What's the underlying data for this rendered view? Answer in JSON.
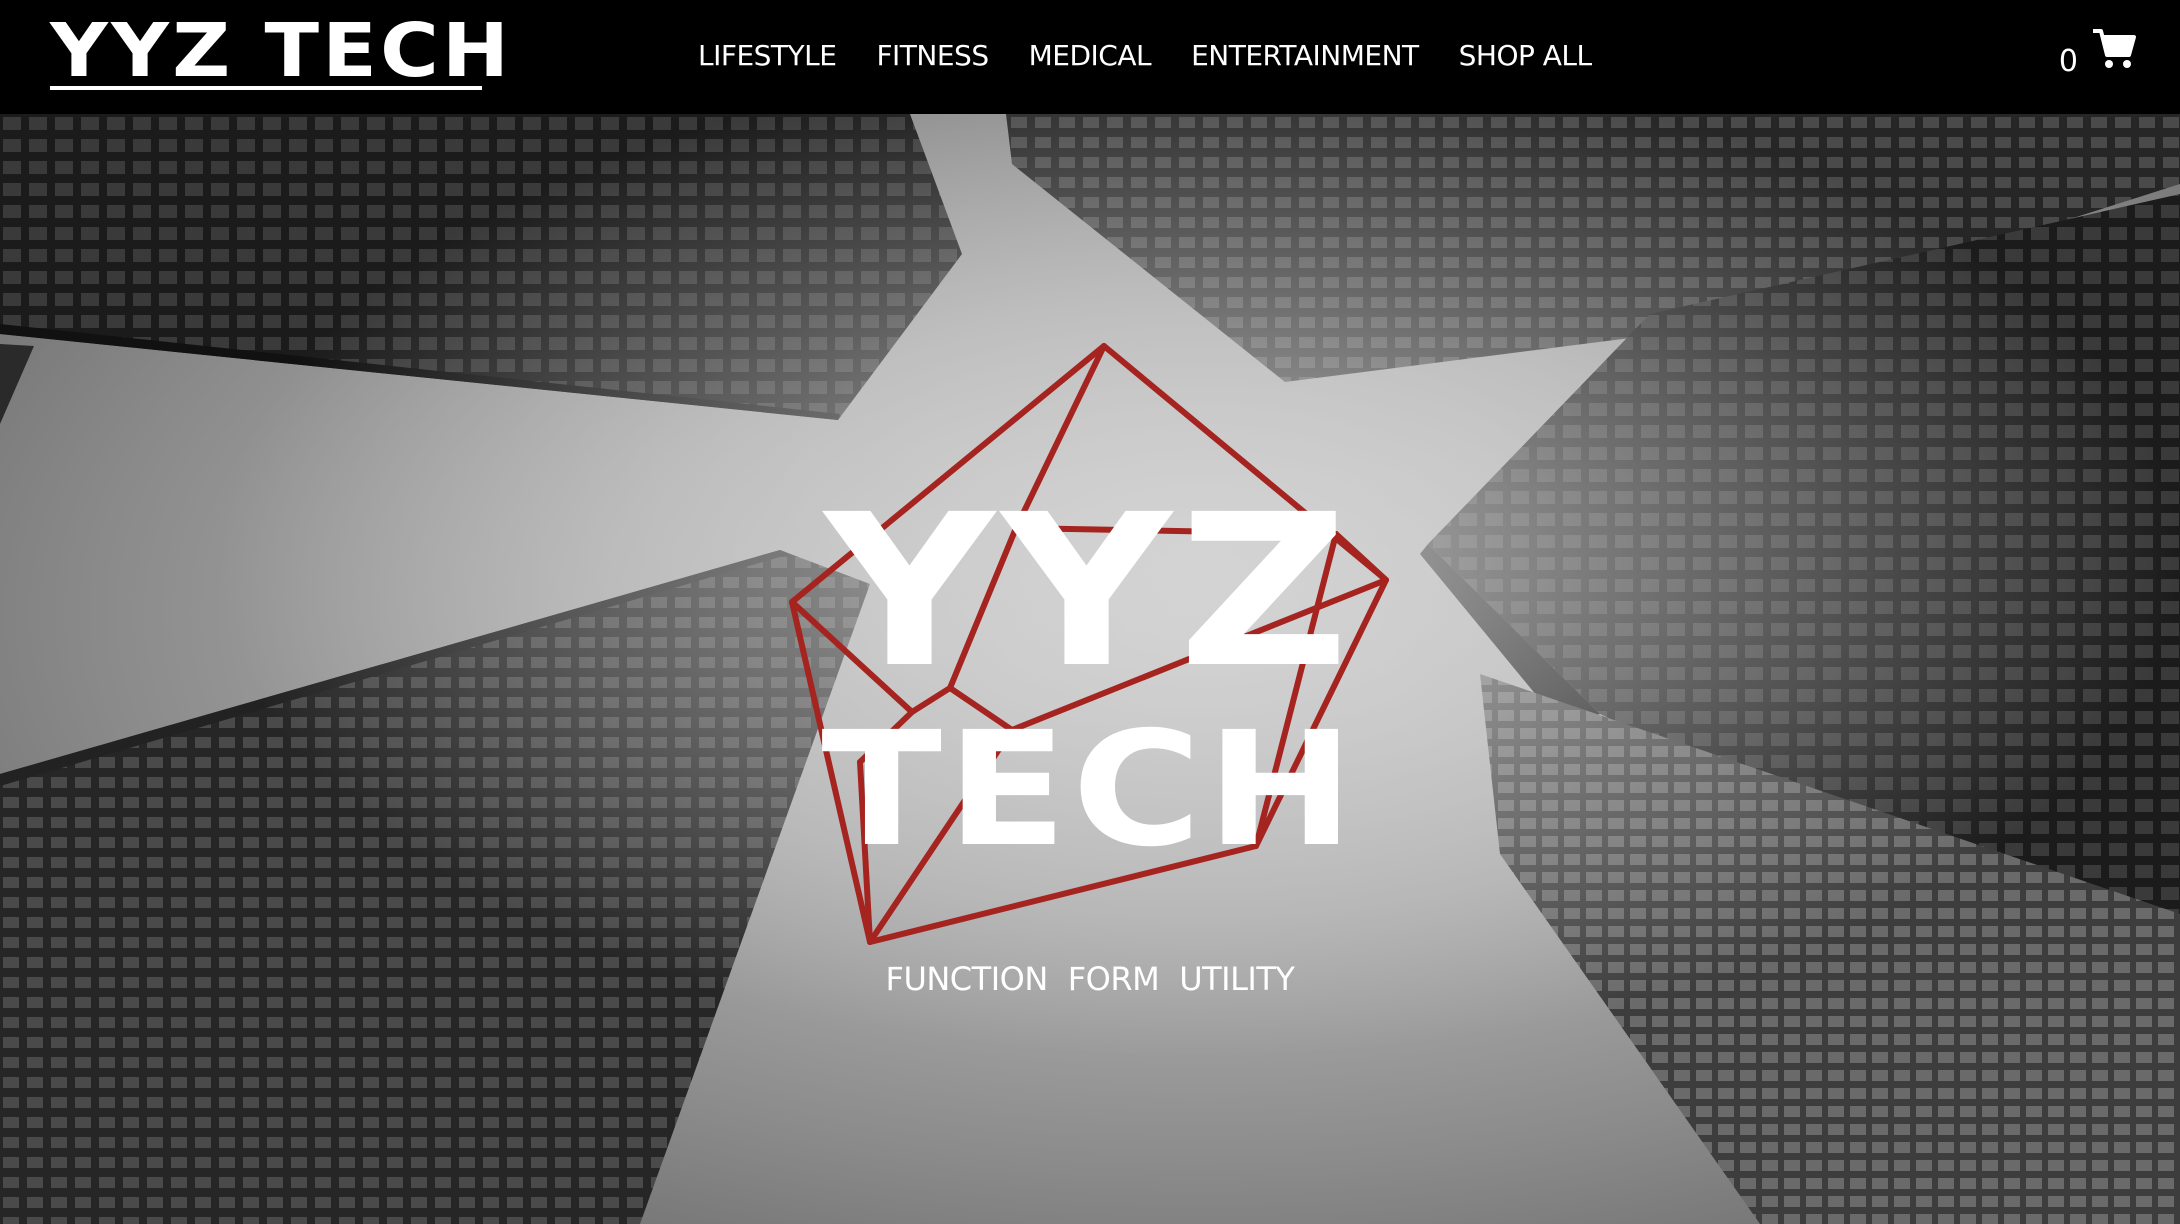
{
  "header": {
    "logo_text": "YYZ TECH",
    "nav": [
      {
        "label": "LIFESTYLE"
      },
      {
        "label": "FITNESS"
      },
      {
        "label": "MEDICAL"
      },
      {
        "label": "ENTERTAINMENT"
      },
      {
        "label": "SHOP ALL"
      }
    ],
    "cart": {
      "count": "0",
      "icon": "shopping-cart-icon"
    }
  },
  "hero": {
    "title_line1": "YYZ",
    "title_line2": "TECH",
    "emblem_icon": "geometric-crystal-outline-icon",
    "emblem_color": "#a52420",
    "tagline": [
      "FUNCTION",
      "FORM",
      "UTILITY"
    ]
  }
}
